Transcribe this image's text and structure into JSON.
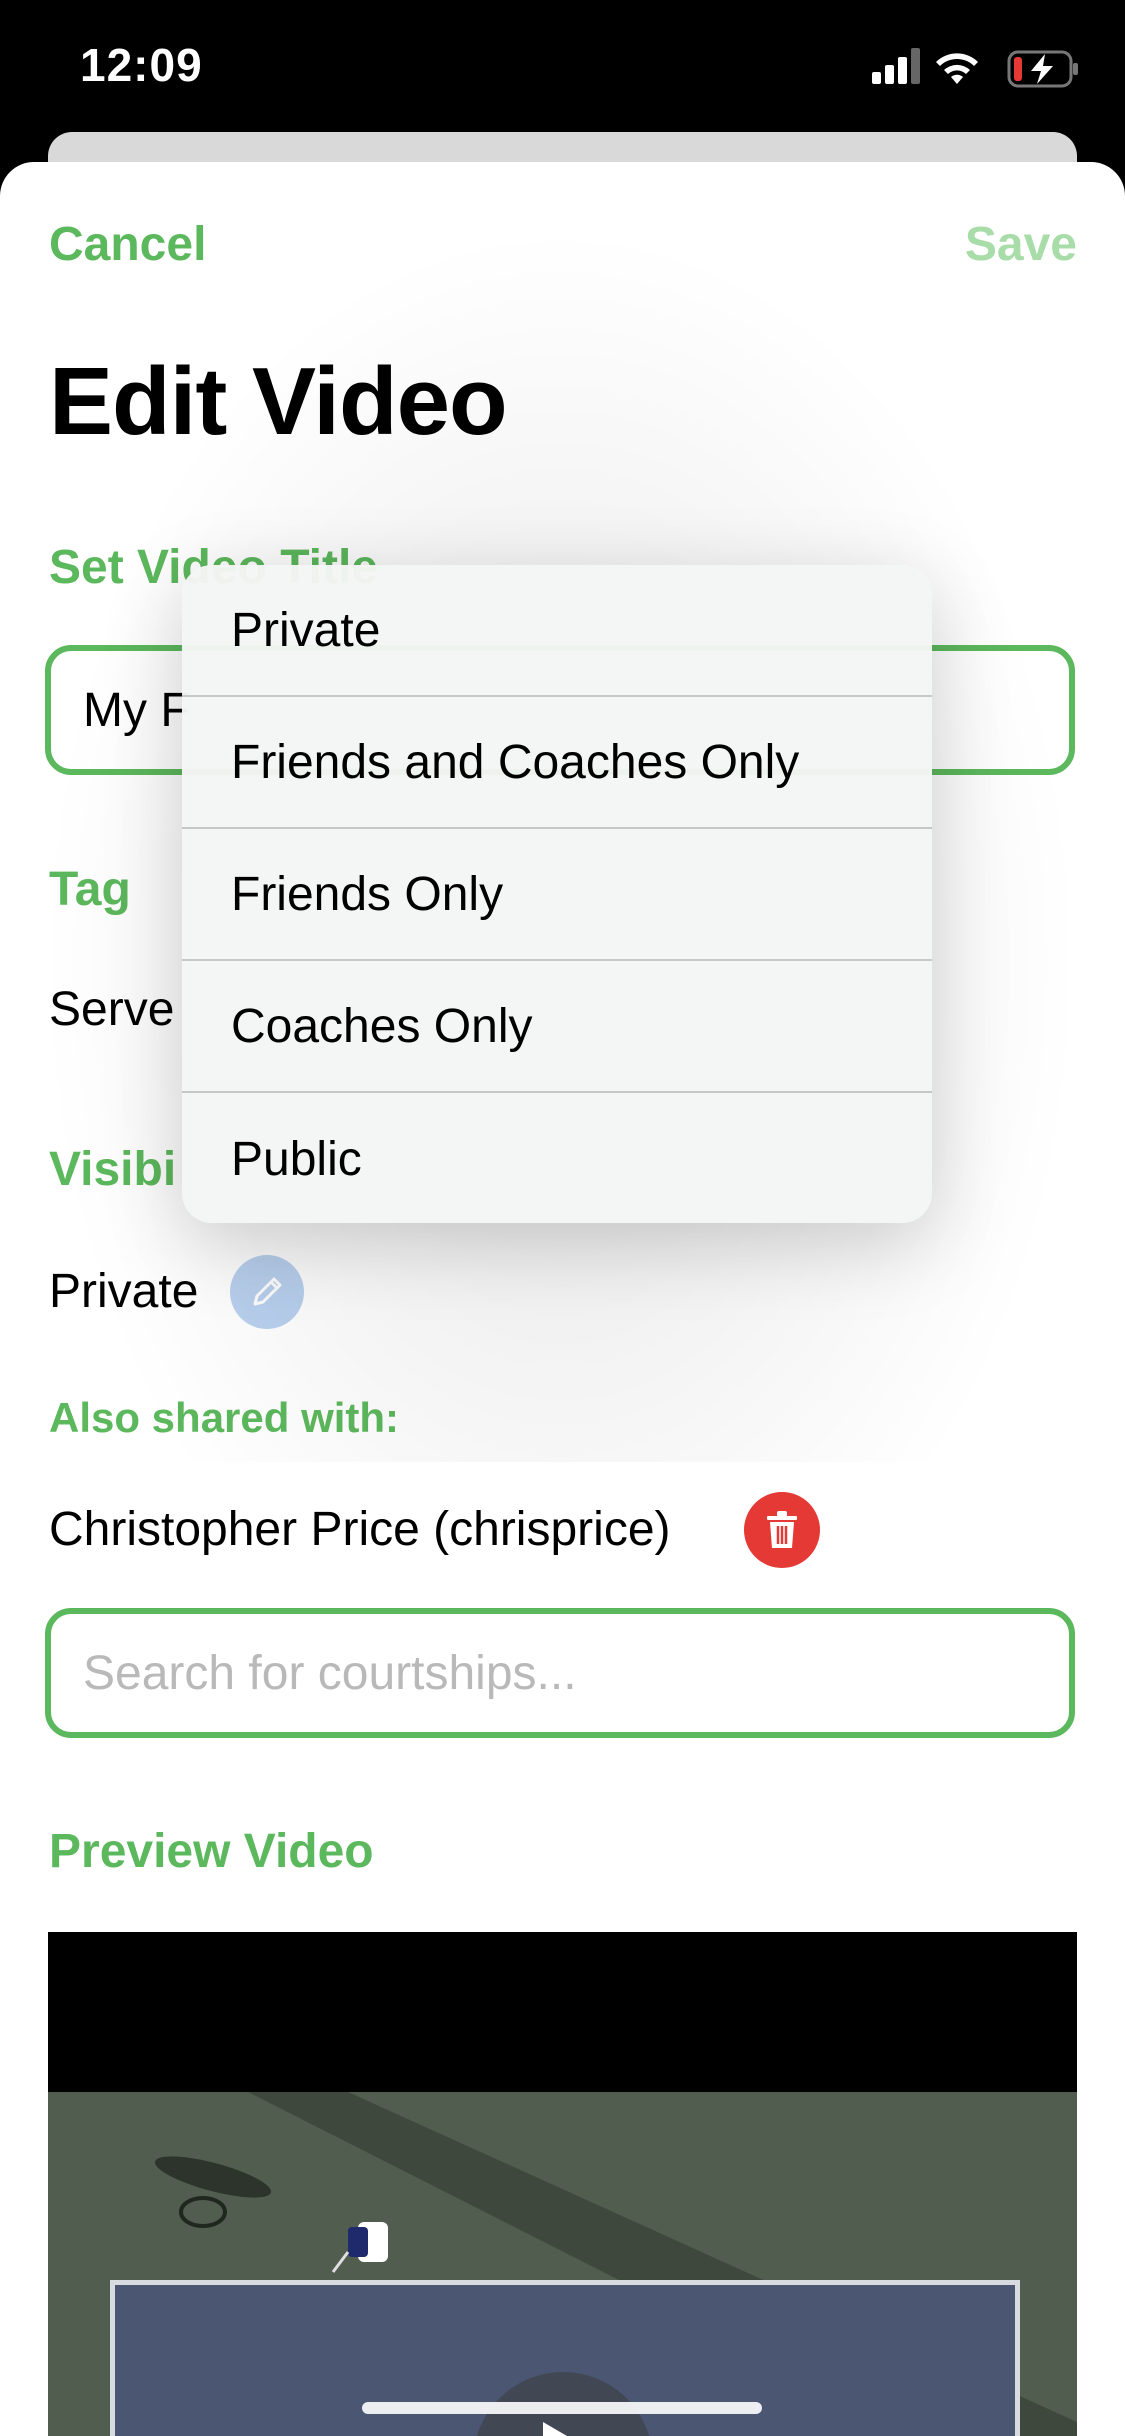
{
  "status_bar": {
    "time": "12:09",
    "icons": [
      "cellular-signal-icon",
      "wifi-icon",
      "battery-charging-icon"
    ]
  },
  "nav": {
    "cancel_label": "Cancel",
    "save_label": "Save"
  },
  "page": {
    "title": "Edit Video"
  },
  "video_title": {
    "label": "Set Video Title",
    "value": "My F"
  },
  "tag": {
    "label": "Tag",
    "value": "Serve"
  },
  "visibility": {
    "label": "Visibi",
    "value": "Private",
    "edit_icon": "pencil-icon"
  },
  "shared": {
    "label": "Also shared with:",
    "users": [
      {
        "name": "Christopher Price (chrisprice)",
        "action_icon": "trash-icon"
      }
    ]
  },
  "search": {
    "placeholder": "Search for courtships..."
  },
  "preview": {
    "label": "Preview Video",
    "play_icon": "play-icon"
  },
  "visibility_menu": {
    "options": [
      "Private",
      "Friends and Coaches Only",
      "Friends Only",
      "Coaches Only",
      "Public"
    ]
  },
  "colors": {
    "accent": "#5cb85c",
    "accent_disabled": "#a8dca8",
    "delete": "#e53935",
    "edit_button": "#b9d1ef"
  }
}
